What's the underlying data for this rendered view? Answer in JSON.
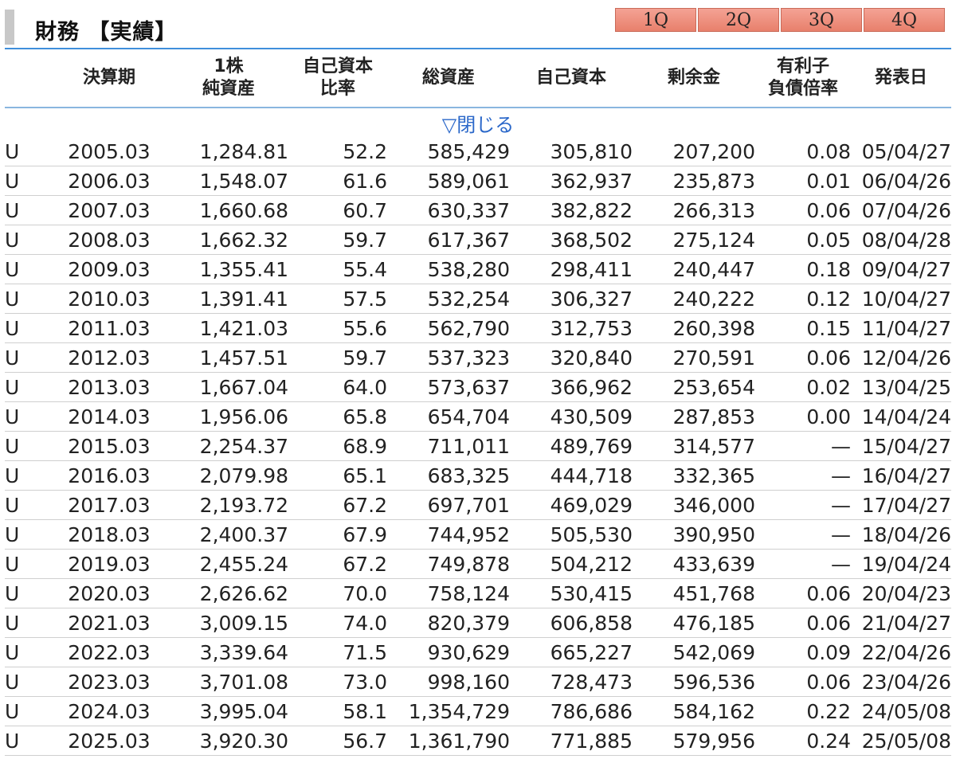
{
  "header": {
    "title": "財務 【実績】",
    "quarter_tabs": [
      "1Q",
      "2Q",
      "3Q",
      "4Q"
    ]
  },
  "table": {
    "columns": [
      "決算期",
      "1株\n純資産",
      "自己資本\n比率",
      "総資産",
      "自己資本",
      "剰余金",
      "有利子\n負債倍率",
      "発表日"
    ],
    "toggle_label": "▽閉じる",
    "rows": [
      {
        "flag": "U",
        "period": "2005.03",
        "bps": "1,284.81",
        "equity_ratio": "52.2",
        "total_assets": "585,429",
        "equity": "305,810",
        "retained": "207,200",
        "debt_ratio": "0.08",
        "date": "05/04/27"
      },
      {
        "flag": "U",
        "period": "2006.03",
        "bps": "1,548.07",
        "equity_ratio": "61.6",
        "total_assets": "589,061",
        "equity": "362,937",
        "retained": "235,873",
        "debt_ratio": "0.01",
        "date": "06/04/26"
      },
      {
        "flag": "U",
        "period": "2007.03",
        "bps": "1,660.68",
        "equity_ratio": "60.7",
        "total_assets": "630,337",
        "equity": "382,822",
        "retained": "266,313",
        "debt_ratio": "0.06",
        "date": "07/04/26"
      },
      {
        "flag": "U",
        "period": "2008.03",
        "bps": "1,662.32",
        "equity_ratio": "59.7",
        "total_assets": "617,367",
        "equity": "368,502",
        "retained": "275,124",
        "debt_ratio": "0.05",
        "date": "08/04/28"
      },
      {
        "flag": "U",
        "period": "2009.03",
        "bps": "1,355.41",
        "equity_ratio": "55.4",
        "total_assets": "538,280",
        "equity": "298,411",
        "retained": "240,447",
        "debt_ratio": "0.18",
        "date": "09/04/27"
      },
      {
        "flag": "U",
        "period": "2010.03",
        "bps": "1,391.41",
        "equity_ratio": "57.5",
        "total_assets": "532,254",
        "equity": "306,327",
        "retained": "240,222",
        "debt_ratio": "0.12",
        "date": "10/04/27"
      },
      {
        "flag": "U",
        "period": "2011.03",
        "bps": "1,421.03",
        "equity_ratio": "55.6",
        "total_assets": "562,790",
        "equity": "312,753",
        "retained": "260,398",
        "debt_ratio": "0.15",
        "date": "11/04/27"
      },
      {
        "flag": "U",
        "period": "2012.03",
        "bps": "1,457.51",
        "equity_ratio": "59.7",
        "total_assets": "537,323",
        "equity": "320,840",
        "retained": "270,591",
        "debt_ratio": "0.06",
        "date": "12/04/26"
      },
      {
        "flag": "U",
        "period": "2013.03",
        "bps": "1,667.04",
        "equity_ratio": "64.0",
        "total_assets": "573,637",
        "equity": "366,962",
        "retained": "253,654",
        "debt_ratio": "0.02",
        "date": "13/04/25"
      },
      {
        "flag": "U",
        "period": "2014.03",
        "bps": "1,956.06",
        "equity_ratio": "65.8",
        "total_assets": "654,704",
        "equity": "430,509",
        "retained": "287,853",
        "debt_ratio": "0.00",
        "date": "14/04/24"
      },
      {
        "flag": "U",
        "period": "2015.03",
        "bps": "2,254.37",
        "equity_ratio": "68.9",
        "total_assets": "711,011",
        "equity": "489,769",
        "retained": "314,577",
        "debt_ratio": "—",
        "date": "15/04/27"
      },
      {
        "flag": "U",
        "period": "2016.03",
        "bps": "2,079.98",
        "equity_ratio": "65.1",
        "total_assets": "683,325",
        "equity": "444,718",
        "retained": "332,365",
        "debt_ratio": "—",
        "date": "16/04/27"
      },
      {
        "flag": "U",
        "period": "2017.03",
        "bps": "2,193.72",
        "equity_ratio": "67.2",
        "total_assets": "697,701",
        "equity": "469,029",
        "retained": "346,000",
        "debt_ratio": "—",
        "date": "17/04/27"
      },
      {
        "flag": "U",
        "period": "2018.03",
        "bps": "2,400.37",
        "equity_ratio": "67.9",
        "total_assets": "744,952",
        "equity": "505,530",
        "retained": "390,950",
        "debt_ratio": "—",
        "date": "18/04/26"
      },
      {
        "flag": "U",
        "period": "2019.03",
        "bps": "2,455.24",
        "equity_ratio": "67.2",
        "total_assets": "749,878",
        "equity": "504,212",
        "retained": "433,639",
        "debt_ratio": "—",
        "date": "19/04/24"
      },
      {
        "flag": "U",
        "period": "2020.03",
        "bps": "2,626.62",
        "equity_ratio": "70.0",
        "total_assets": "758,124",
        "equity": "530,415",
        "retained": "451,768",
        "debt_ratio": "0.06",
        "date": "20/04/23"
      },
      {
        "flag": "U",
        "period": "2021.03",
        "bps": "3,009.15",
        "equity_ratio": "74.0",
        "total_assets": "820,379",
        "equity": "606,858",
        "retained": "476,185",
        "debt_ratio": "0.06",
        "date": "21/04/27"
      },
      {
        "flag": "U",
        "period": "2022.03",
        "bps": "3,339.64",
        "equity_ratio": "71.5",
        "total_assets": "930,629",
        "equity": "665,227",
        "retained": "542,069",
        "debt_ratio": "0.09",
        "date": "22/04/26"
      },
      {
        "flag": "U",
        "period": "2023.03",
        "bps": "3,701.08",
        "equity_ratio": "73.0",
        "total_assets": "998,160",
        "equity": "728,473",
        "retained": "596,536",
        "debt_ratio": "0.06",
        "date": "23/04/26"
      },
      {
        "flag": "U",
        "period": "2024.03",
        "bps": "3,995.04",
        "equity_ratio": "58.1",
        "total_assets": "1,354,729",
        "equity": "786,686",
        "retained": "584,162",
        "debt_ratio": "0.22",
        "date": "24/05/08"
      },
      {
        "flag": "U",
        "period": "2025.03",
        "bps": "3,920.30",
        "equity_ratio": "56.7",
        "total_assets": "1,361,790",
        "equity": "771,885",
        "retained": "579,956",
        "debt_ratio": "0.24",
        "date": "25/05/08"
      }
    ]
  },
  "colors": {
    "accent_blue": "#3f8fdb",
    "link_blue": "#2a67c9",
    "tab_fill": "#e8806c"
  }
}
